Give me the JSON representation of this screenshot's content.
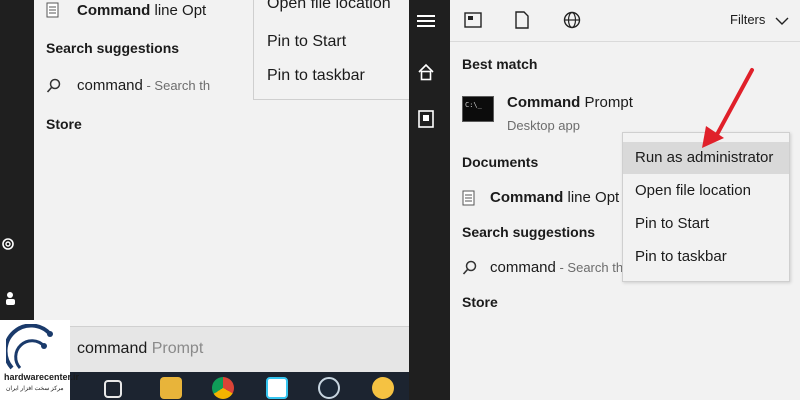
{
  "left": {
    "documents_item": {
      "bold": "Command",
      "rest": " line Opt"
    },
    "search_suggestions_header": "Search suggestions",
    "suggestion": {
      "text": "command",
      "hint": " - Search th"
    },
    "store_header": "Store",
    "context_menu": [
      "Open file location",
      "Pin to Start",
      "Pin to taskbar"
    ],
    "search_box": {
      "typed": "command",
      "completion": " Prompt"
    }
  },
  "right": {
    "filters_label": "Filters",
    "best_match_header": "Best match",
    "best_match": {
      "title_bold": "Command",
      "title_rest": " Prompt",
      "subtitle": "Desktop app"
    },
    "documents_header": "Documents",
    "documents_item": {
      "bold": "Command",
      "rest": " line Opt"
    },
    "search_suggestions_header": "Search suggestions",
    "suggestion": {
      "text": "command",
      "hint": " - Search th"
    },
    "store_header": "Store",
    "context_menu": [
      "Run as administrator",
      "Open file location",
      "Pin to Start",
      "Pin to taskbar"
    ],
    "highlighted_index": 0
  },
  "logo": {
    "name": "hardwarecenter.ir",
    "tagline": "مرکز سخت افزار ایران"
  },
  "colors": {
    "arrow": "#e0202a",
    "rail": "#1f1f1f",
    "panel": "#f2f2f2",
    "highlight": "#d9d9d9"
  }
}
